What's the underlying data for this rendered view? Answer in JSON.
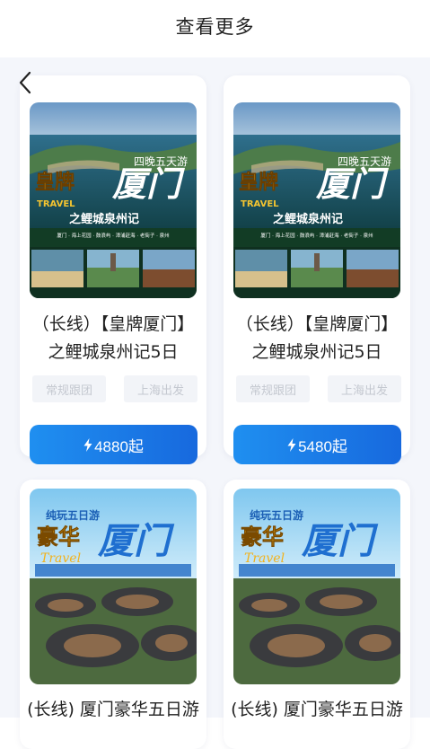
{
  "header": {
    "title": "查看更多"
  },
  "icons": {
    "back": "chevron-left-icon",
    "price": "lightning-bolt-icon"
  },
  "colors": {
    "button_start": "#1f8ff0",
    "button_end": "#1769de"
  },
  "products": [
    {
      "name": "（长线）【皇牌厦门】之鲤城泉州记5日",
      "tags": [
        "常规跟团",
        "上海出发"
      ],
      "price": "4880起",
      "poster": {
        "badge": "四晚五天游",
        "brand": "皇牌",
        "city": "厦门",
        "travel": "TRAVEL",
        "subtitle": "之鲤城泉州记",
        "route": "厦门 · 海上花园 · 鼓浪屿 · 漳浦赶海 · 老街子 · 泉州"
      }
    },
    {
      "name": "（长线）【皇牌厦门】之鲤城泉州记5日",
      "tags": [
        "常规跟团",
        "上海出发"
      ],
      "price": "5480起",
      "poster": {
        "badge": "四晚五天游",
        "brand": "皇牌",
        "city": "厦门",
        "travel": "TRAVEL",
        "subtitle": "之鲤城泉州记",
        "route": "厦门 · 海上花园 · 鼓浪屿 · 漳浦赶海 · 老街子 · 泉州"
      }
    },
    {
      "name": "(长线) 厦门豪华五日游",
      "poster": {
        "badge": "纯玩五日游",
        "brand": "豪华",
        "city": "厦门",
        "travel": "Travel"
      }
    },
    {
      "name": "(长线) 厦门豪华五日游",
      "poster": {
        "badge": "纯玩五日游",
        "brand": "豪华",
        "city": "厦门",
        "travel": "Travel"
      }
    }
  ]
}
